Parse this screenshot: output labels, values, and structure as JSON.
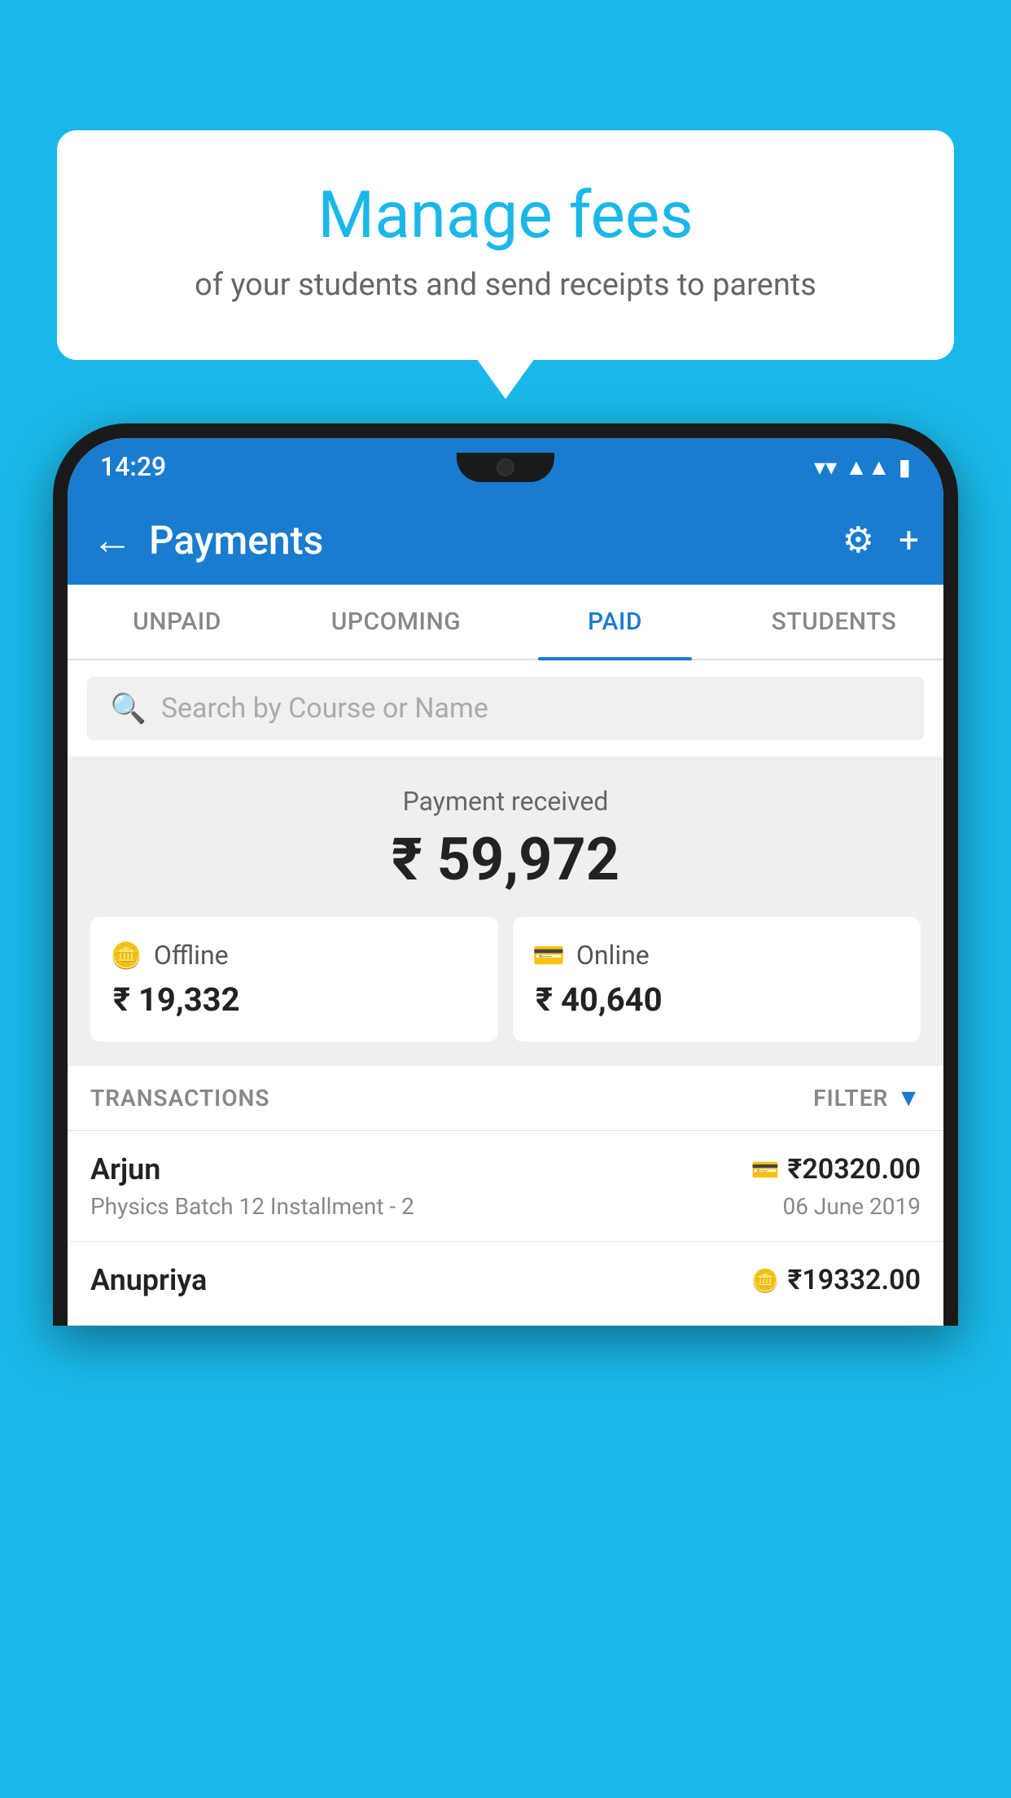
{
  "background_color": "#1ab8e8",
  "bubble": {
    "title": "Manage fees",
    "subtitle": "of your students and send receipts to parents"
  },
  "phone": {
    "status_bar": {
      "time": "14:29",
      "icons": [
        "wifi",
        "signal",
        "battery"
      ]
    },
    "app_bar": {
      "title": "Payments",
      "back_icon": "←",
      "settings_icon": "⚙",
      "add_icon": "+"
    },
    "tabs": [
      {
        "label": "UNPAID",
        "active": false
      },
      {
        "label": "UPCOMING",
        "active": false
      },
      {
        "label": "PAID",
        "active": true
      },
      {
        "label": "STUDENTS",
        "active": false
      }
    ],
    "search": {
      "placeholder": "Search by Course or Name"
    },
    "payment_section": {
      "label": "Payment received",
      "amount": "₹ 59,972",
      "offline": {
        "label": "Offline",
        "amount": "₹ 19,332"
      },
      "online": {
        "label": "Online",
        "amount": "₹ 40,640"
      }
    },
    "transactions": {
      "header": "TRANSACTIONS",
      "filter": "FILTER",
      "rows": [
        {
          "name": "Arjun",
          "course": "Physics Batch 12 Installment - 2",
          "amount": "₹20320.00",
          "date": "06 June 2019",
          "payment_type": "card"
        },
        {
          "name": "Anupriya",
          "course": "",
          "amount": "₹19332.00",
          "date": "",
          "payment_type": "offline"
        }
      ]
    }
  }
}
